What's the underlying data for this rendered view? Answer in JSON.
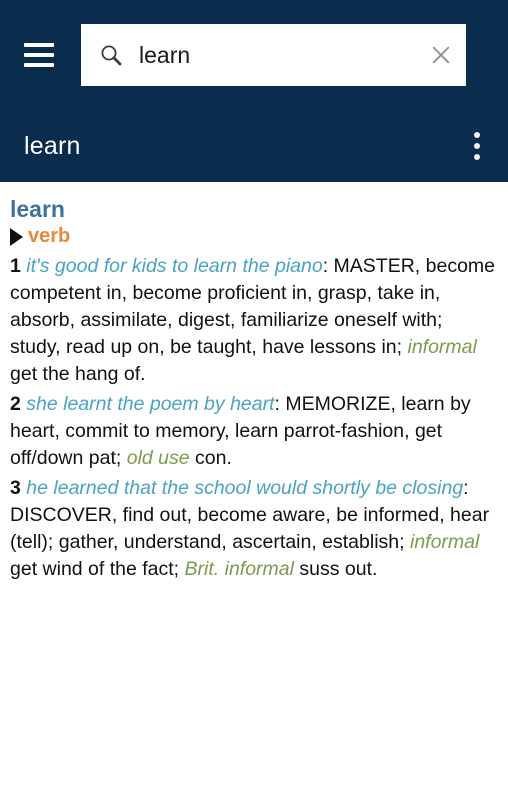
{
  "appbar": {
    "menu_icon": "hamburger-menu-icon",
    "search": {
      "icon": "search-icon",
      "value": "learn",
      "placeholder": "Search",
      "clear_icon": "close-icon"
    },
    "title": "learn",
    "overflow_icon": "more-vertical-icon",
    "background_color": "#0a2d4d"
  },
  "entry": {
    "headword": "learn",
    "part_of_speech": "verb",
    "pos_expand_icon": "triangle-right-icon",
    "colors": {
      "headword": "#3f72a4",
      "part_of_speech": "#e8883a",
      "example": "#4aa3c0",
      "register": "#7d9b4e",
      "body": "#111111"
    },
    "senses": [
      {
        "number": "1",
        "example": "it's good for kids to learn the piano",
        "separator": ": ",
        "synonyms_before": "MASTER, become competent in, become proficient in, grasp, take in, absorb, assimilate, digest, familiarize oneself with; study, read up on, be taught, have lessons in; ",
        "register": "informal",
        "synonyms_after": " get the hang of."
      },
      {
        "number": "2",
        "example": "she learnt the poem by heart",
        "separator": ": ",
        "synonyms_before": "MEMORIZE, learn by heart, commit to memory, learn parrot-fashion, get off/down pat; ",
        "register": "old use",
        "synonyms_after": " con."
      },
      {
        "number": "3",
        "example": "he learned that the school would shortly be closing",
        "separator": ": ",
        "synonyms_before": "DISCOVER, find out, become aware, be informed, hear (tell); gather, understand, ascertain, establish; ",
        "register": "informal",
        "synonyms_mid": " get wind of the fact; ",
        "register2": "Brit. informal",
        "synonyms_after": " suss out."
      }
    ]
  }
}
